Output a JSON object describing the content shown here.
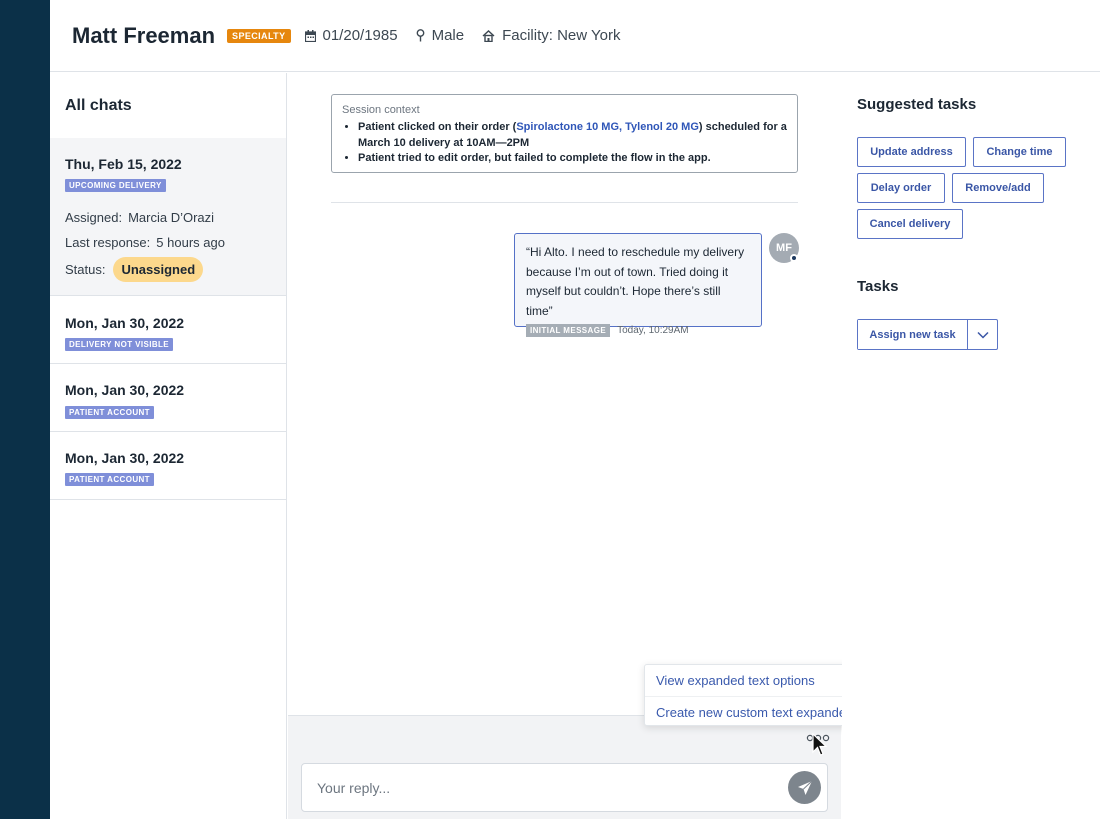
{
  "header": {
    "patient_name": "Matt Freeman",
    "badge": "SPECIALTY",
    "dob": "01/20/1985",
    "gender": "Male",
    "facility": "Facility: New York"
  },
  "chats": {
    "title": "All chats",
    "items": [
      {
        "date": "Thu, Feb 15, 2022",
        "tag": "UPCOMING DELIVERY",
        "assigned_label": "Assigned:",
        "assigned_value": "Marcia D’Orazi",
        "last_response_label": "Last response:",
        "last_response_value": "5 hours ago",
        "status_label": "Status:",
        "status_value": "Unassigned"
      },
      {
        "date": "Mon, Jan 30, 2022",
        "tag": "DELIVERY NOT VISIBLE"
      },
      {
        "date": "Mon, Jan 30, 2022",
        "tag": "PATIENT ACCOUNT"
      },
      {
        "date": "Mon, Jan 30, 2022",
        "tag": "PATIENT ACCOUNT"
      }
    ]
  },
  "session": {
    "title": "Session context",
    "line1_prefix": "Patient clicked on their order (",
    "line1_drugs": "Spirolactone 10 MG, Tylenol 20 MG",
    "line1_suffix": ") scheduled for a March 10 delivery at 10AM—2PM",
    "line2": "Patient tried to edit order, but failed to complete the flow in the app."
  },
  "message": {
    "text": "“Hi Alto. I need to reschedule my delivery because I’m out of town. Tried doing it myself but couldn’t. Hope there’s still time”",
    "tag": "INITIAL MESSAGE",
    "time": "Today, 10:29AM",
    "avatar_initials": "MF"
  },
  "reply": {
    "placeholder": "Your reply..."
  },
  "expander_menu": {
    "items": [
      "View expanded text options",
      "Create new custom text expander"
    ]
  },
  "suggested": {
    "title": "Suggested tasks",
    "buttons": [
      "Update address",
      "Change time",
      "Delay order",
      "Remove/add",
      "Cancel delivery"
    ]
  },
  "tasks": {
    "title": "Tasks",
    "assign_label": "Assign new task"
  },
  "colors": {
    "nav_rail": "#0b3048",
    "accent": "#3a56a6",
    "specialty_badge": "#e6870e",
    "chat_tag": "#7f8fd9",
    "status_pill": "#fcd88c"
  }
}
